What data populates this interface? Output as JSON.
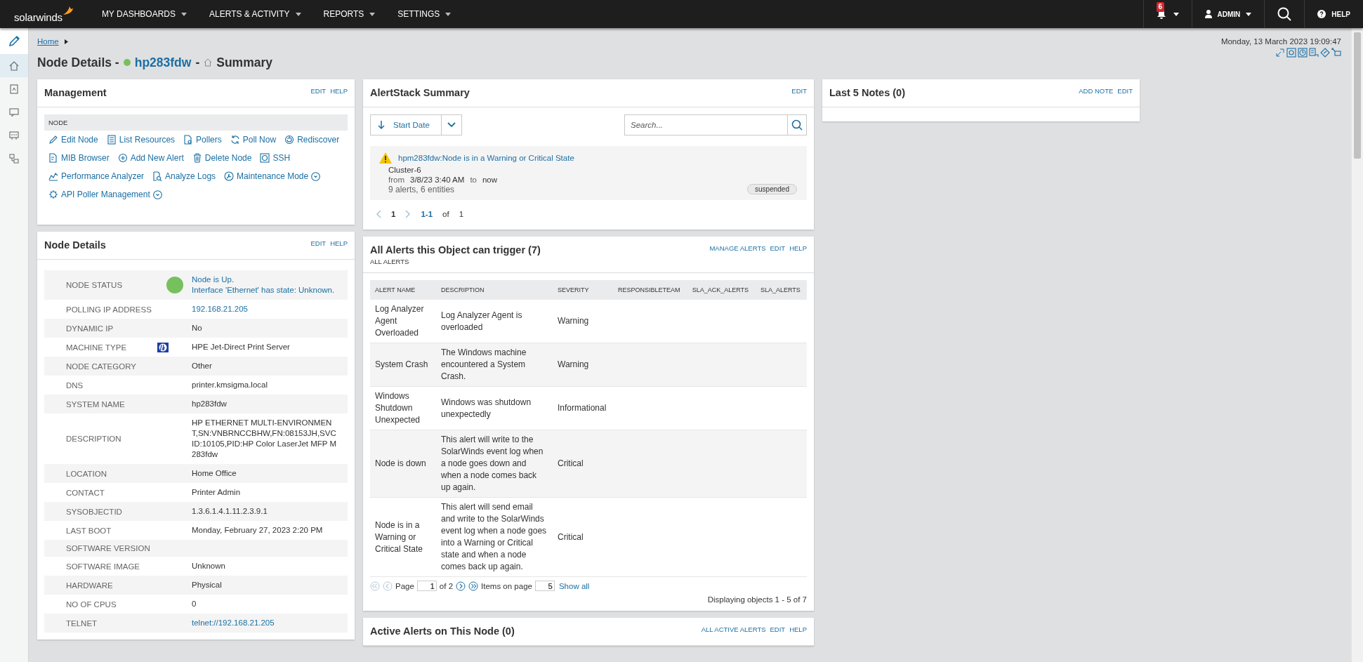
{
  "topnav": {
    "logo": "solarwinds",
    "menus": [
      "MY DASHBOARDS",
      "ALERTS & ACTIVITY",
      "REPORTS",
      "SETTINGS"
    ],
    "notifications": "6",
    "user": "ADMIN",
    "help": "HELP"
  },
  "sidebar": {
    "items": [
      {
        "selected": true
      },
      {
        "selected": false
      },
      {
        "selected": false
      },
      {
        "selected": false
      },
      {
        "selected": false
      }
    ]
  },
  "breadcrumb": {
    "link": "Home"
  },
  "datetime": "Monday, 13 March 2023 19:09:47",
  "page_title": {
    "prefix": "Node Details -",
    "up": true,
    "node": "hp283fdw",
    "separator": "-",
    "view": "Summary"
  },
  "management": {
    "title": "Management",
    "actions": [
      "EDIT",
      "HELP"
    ],
    "section": "NODE",
    "rows": [
      [
        {
          "label": "Edit Node",
          "menu": false
        },
        {
          "label": "List Resources",
          "menu": false
        },
        {
          "label": "Pollers",
          "menu": false
        },
        {
          "label": "Poll Now",
          "menu": false
        },
        {
          "label": "Rediscover",
          "menu": false
        }
      ],
      [
        {
          "label": "MIB Browser",
          "menu": false
        },
        {
          "label": "Add New Alert",
          "menu": false
        },
        {
          "label": "Delete Node",
          "menu": false
        },
        {
          "label": "SSH",
          "menu": false
        }
      ],
      [
        {
          "label": "Performance Analyzer",
          "menu": false
        },
        {
          "label": "Analyze Logs",
          "menu": false
        },
        {
          "label": "Maintenance Mode",
          "menu": true
        }
      ],
      [
        {
          "label": "API Poller Management",
          "menu": true
        }
      ]
    ]
  },
  "node_details": {
    "title": "Node Details",
    "actions": [
      "EDIT",
      "HELP"
    ],
    "rows": [
      {
        "kind": "status",
        "label": "NODE STATUS",
        "up": true,
        "lines": [
          "Node is Up.",
          "Interface 'Ethernet' has state: Unknown."
        ]
      },
      {
        "kind": "link",
        "label": "POLLING IP ADDRESS",
        "value": "192.168.21.205"
      },
      {
        "kind": "text",
        "label": "DYNAMIC IP",
        "value": "No"
      },
      {
        "kind": "vendor",
        "label": "MACHINE TYPE",
        "value": "HPE Jet-Direct Print Server"
      },
      {
        "kind": "text",
        "label": "NODE CATEGORY",
        "value": "Other"
      },
      {
        "kind": "text",
        "label": "DNS",
        "value": "printer.kmsigma.local"
      },
      {
        "kind": "text",
        "label": "SYSTEM NAME",
        "value": "hp283fdw"
      },
      {
        "kind": "text",
        "label": "DESCRIPTION",
        "value": "HP ETHERNET MULTI-ENVIRONMENT,SN:VNBRNCCBHW,FN:08153JH,SVCID:10105,PID:HP Color LaserJet MFP M283fdw"
      },
      {
        "kind": "text",
        "label": "LOCATION",
        "value": "Home Office"
      },
      {
        "kind": "text",
        "label": "CONTACT",
        "value": "Printer Admin"
      },
      {
        "kind": "text",
        "label": "SYSOBJECTID",
        "value": "1.3.6.1.4.1.11.2.3.9.1"
      },
      {
        "kind": "text",
        "label": "LAST BOOT",
        "value": "Monday, February 27, 2023 2:20 PM"
      },
      {
        "kind": "text",
        "label": "SOFTWARE VERSION"
      },
      {
        "kind": "text",
        "label": "SOFTWARE IMAGE",
        "value": "Unknown"
      },
      {
        "kind": "text",
        "label": "HARDWARE",
        "value": "Physical"
      },
      {
        "kind": "text",
        "label": "NO OF CPUS",
        "value": "0"
      },
      {
        "kind": "link",
        "label": "TELNET",
        "value": "telnet://192.168.21.205"
      }
    ]
  },
  "alertstack": {
    "title": "AlertStack Summary",
    "actions": [
      "EDIT"
    ],
    "sort": "Start Date",
    "search": {
      "placeholder": "Search..."
    },
    "alert": {
      "title": "hpm283fdw:Node is in a Warning or Critical State",
      "cluster": "Cluster-6",
      "from_label": "from",
      "from": "3/8/23 3:40 AM",
      "to_label": "to",
      "to": "now",
      "counts": "9 alerts, 6 entities",
      "badge": "suspended"
    },
    "pager": {
      "page": "1",
      "range": "1-1",
      "of": "of",
      "total": "1"
    }
  },
  "all_alerts": {
    "title": "All Alerts this Object can trigger (7)",
    "subtitle": "ALL ALERTS",
    "actions": [
      "MANAGE ALERTS",
      "EDIT",
      "HELP"
    ],
    "columns": [
      "ALERT NAME",
      "DESCRIPTION",
      "SEVERITY",
      "RESPONSIBLETEAM",
      "SLA_ACK_ALERTS",
      "SLA_ALERTS"
    ],
    "rows": [
      {
        "name": "Log Analyzer Agent Overloaded",
        "description": "Log Analyzer Agent is overloaded",
        "severity": "Warning"
      },
      {
        "name": "System Crash",
        "description": "The Windows machine encountered a System Crash.",
        "severity": "Warning"
      },
      {
        "name": "Windows Shutdown Unexpected",
        "description": "Windows was shutdown unexpectedly",
        "severity": "Informational"
      },
      {
        "name": "Node is down",
        "description": "This alert will write to the SolarWinds event log when a node goes down and when a node comes back up again.",
        "severity": "Critical"
      },
      {
        "name": "Node is in a Warning or Critical State",
        "description": "This alert will send email and write to the SolarWinds event log when a node goes into a Warning or Critical state and when a node comes back up again.",
        "severity": "Critical"
      }
    ],
    "pager": {
      "page_label": "Page",
      "page": "1",
      "of": "of 2",
      "items_label": "Items on page",
      "items": "5",
      "show_all": "Show all",
      "summary": "Displaying objects 1 - 5 of 7"
    }
  },
  "active_alerts": {
    "title": "Active Alerts on This Node (0)",
    "actions": [
      "ALL ACTIVE ALERTS",
      "EDIT",
      "HELP"
    ]
  },
  "notes": {
    "title": "Last 5 Notes (0)",
    "actions": [
      "ADD NOTE",
      "EDIT"
    ]
  }
}
